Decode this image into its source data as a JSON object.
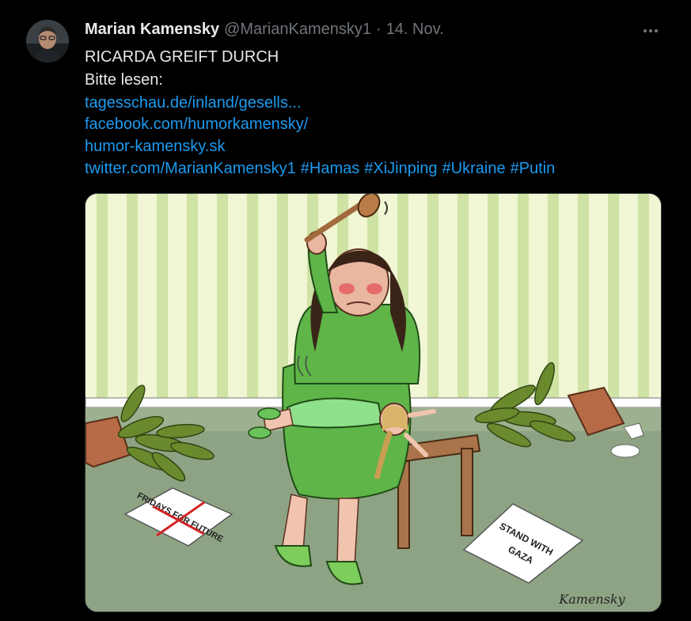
{
  "tweet": {
    "author_name": "Marian Kamensky",
    "handle": "@MarianKamensky1",
    "separator": "·",
    "date": "14. Nov.",
    "line1": "RICARDA GREIFT DURCH",
    "line2": "Bitte lesen:",
    "links": [
      "tagesschau.de/inland/gesells...",
      "facebook.com/humorkamensky/",
      "humor-kamensky.sk",
      "twitter.com/MarianKamensky1"
    ],
    "hashtags": [
      "#Hamas",
      "#XiJinping",
      "#Ukraine",
      "#Putin"
    ]
  },
  "cartoon": {
    "sign_left": "FRIDAYS FOR FUTURE",
    "sign_right_1": "STAND WITH",
    "sign_right_2": "GAZA",
    "signature": "Kamensky"
  },
  "colors": {
    "background": "#000000",
    "text": "#e7e9ea",
    "muted": "#71767b",
    "link": "#1d9bf0"
  },
  "icons": {
    "more": "more-horizontal-icon",
    "avatar": "user-avatar"
  }
}
